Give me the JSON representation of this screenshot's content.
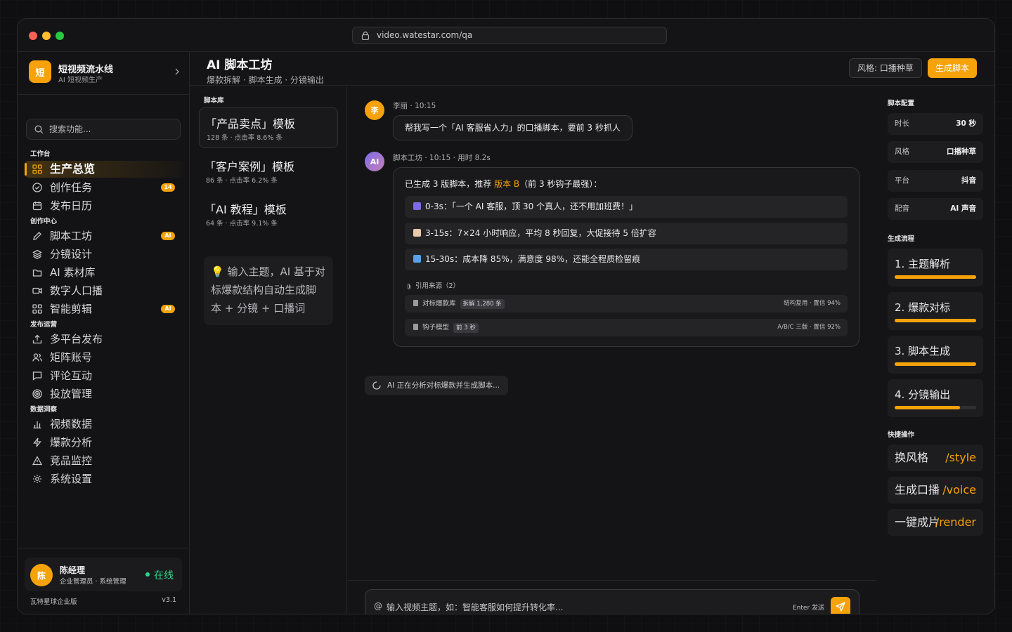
{
  "browser": {
    "url": "video.watestar.com/qa"
  },
  "colors": {
    "accent": "#f5a20b",
    "online": "#2bd98a",
    "ai_avatar": "#9b6fd8"
  },
  "sidebar": {
    "brand_logo": "短",
    "brand_title": "短视频流水线",
    "brand_sub": "AI 短视频生产",
    "search_placeholder": "搜索功能...",
    "sections": [
      {
        "label": "工作台"
      },
      {
        "label": "创作中心"
      },
      {
        "label": "发布运营"
      },
      {
        "label": "数据洞察"
      }
    ],
    "items": [
      {
        "label": "生产总览",
        "icon": "grid-icon",
        "active": true
      },
      {
        "label": "创作任务",
        "icon": "check-circle-icon",
        "badge": "14"
      },
      {
        "label": "发布日历",
        "icon": "calendar-icon"
      },
      {
        "label": "脚本工坊",
        "icon": "pencil-icon",
        "badge": "AI"
      },
      {
        "label": "分镜设计",
        "icon": "layers-icon"
      },
      {
        "label": "AI 素材库",
        "icon": "folder-icon"
      },
      {
        "label": "数字人口播",
        "icon": "video-camera-icon"
      },
      {
        "label": "智能剪辑",
        "icon": "grid-icon",
        "badge": "AI"
      },
      {
        "label": "多平台发布",
        "icon": "upload-icon"
      },
      {
        "label": "矩阵账号",
        "icon": "users-icon"
      },
      {
        "label": "评论互动",
        "icon": "comment-icon"
      },
      {
        "label": "投放管理",
        "icon": "target-icon"
      },
      {
        "label": "视频数据",
        "icon": "bar-chart-icon"
      },
      {
        "label": "爆款分析",
        "icon": "lightning-icon"
      },
      {
        "label": "竞品监控",
        "icon": "warning-icon"
      },
      {
        "label": "系统设置",
        "icon": "gear-icon"
      }
    ],
    "user": {
      "avatar": "陈",
      "name": "陈经理",
      "role": "企业管理员 · 系统管理",
      "status": "在线"
    },
    "edition": "瓦特星球企业版",
    "version": "v3.1"
  },
  "header": {
    "title": "AI 脚本工坊",
    "subtitle": "爆款拆解 · 脚本生成 · 分镜输出",
    "style_pill": "风格: 口播种草",
    "generate_button": "生成脚本"
  },
  "library": {
    "label": "脚本库",
    "items": [
      {
        "title": "「产品卖点」模板",
        "meta": "128 条 · 点击率 8.6% 条"
      },
      {
        "title": "「客户案例」模板",
        "meta": "86 条 · 点击率 6.2% 条"
      },
      {
        "title": "「AI 教程」模板",
        "meta": "64 条 · 点击率 9.1% 条"
      }
    ],
    "tip": "💡 输入主题，AI 基于对标爆款结构自动生成脚本 + 分镜 + 口播词"
  },
  "chat": {
    "user_msg": {
      "avatar": "李",
      "meta": "李丽 · 10:15",
      "text": "帮我写一个「AI 客服省人力」的口播脚本，要前 3 秒抓人"
    },
    "ai_msg": {
      "avatar": "AI",
      "meta": "脚本工坊 · 10:15 · 用时 8.2s",
      "lead_prefix": "已生成 3 版脚本，推荐 ",
      "lead_highlight": "版本 B",
      "lead_suffix": "（前 3 秒钩子最强）：",
      "segments": [
        {
          "emoji": "clapper-icon",
          "color": "#7d6be0",
          "text": "0-3s：「一个 AI 客服，顶 30 个真人，还不用加班费！」"
        },
        {
          "emoji": "memo-icon",
          "color": "#e8c9a8",
          "text": "3-15s：7×24 小时响应，平均 8 秒回复，大促接待 5 倍扩容"
        },
        {
          "emoji": "bar-chart-icon",
          "color": "#5aa0e8",
          "text": "15-30s：成本降 85%，满意度 98%，还能全程质检留痕"
        }
      ],
      "refs_label": "引用来源（2）",
      "refs": [
        {
          "name": "对标爆款库",
          "tag": "拆解 1,280 条",
          "right": "结构复用 · 置信 94%"
        },
        {
          "name": "钩子模型",
          "tag": "前 3 秒",
          "right": "A/B/C 三版 · 置信 92%"
        }
      ]
    },
    "thinking": "AI 正在分析对标爆款并生成脚本...",
    "input_placeholder": "输入视频主题，如：智能客服如何提升转化率...",
    "input_at": "@",
    "send_hint": "Enter 发送"
  },
  "right_panel": {
    "config_label": "脚本配置",
    "config": [
      {
        "key": "时长",
        "value": "30 秒"
      },
      {
        "key": "风格",
        "value": "口播种草"
      },
      {
        "key": "平台",
        "value": "抖音"
      },
      {
        "key": "配音",
        "value": "AI 声音"
      }
    ],
    "flow_label": "生成流程",
    "steps": [
      {
        "label": "1. 主题解析",
        "progress": 1.0
      },
      {
        "label": "2. 爆款对标",
        "progress": 1.0
      },
      {
        "label": "3. 脚本生成",
        "progress": 1.0
      },
      {
        "label": "4. 分镜输出",
        "progress": 0.8
      }
    ],
    "quick_label": "快捷操作",
    "quick": [
      {
        "label": "换风格",
        "cmd": "/style"
      },
      {
        "label": "生成口播",
        "cmd": "/voice"
      },
      {
        "label": "一键成片",
        "cmd": "/render"
      }
    ]
  }
}
